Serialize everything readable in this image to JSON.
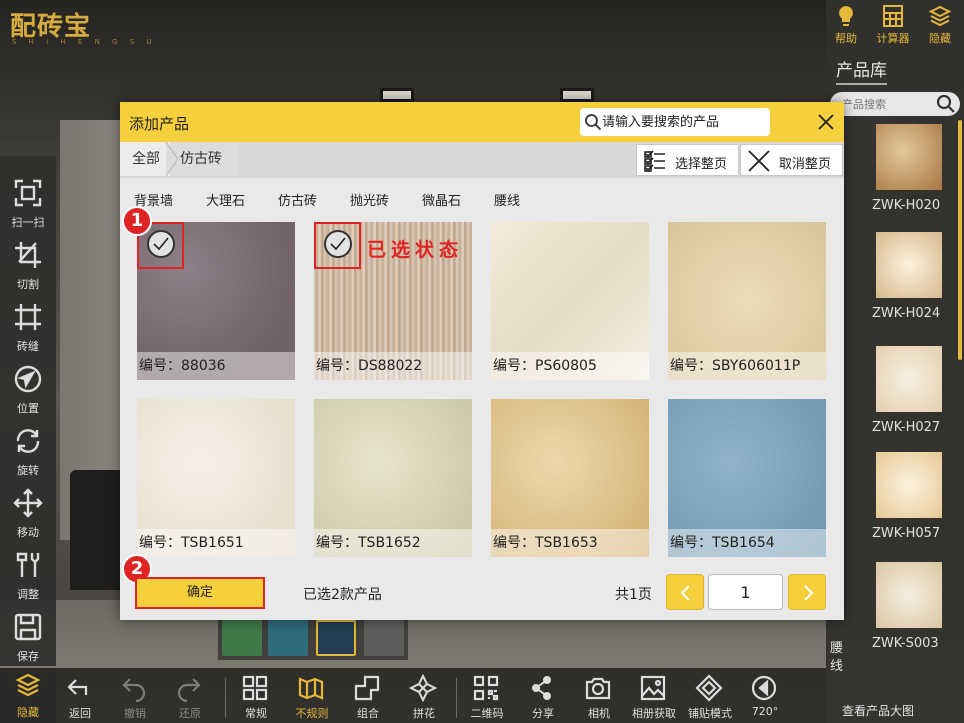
{
  "app": {
    "logo": "配砖宝",
    "logo_sub": "S H I H E N G S U"
  },
  "left_toolbar": [
    {
      "id": "scan",
      "label": "扫一扫",
      "icon": "scan-icon"
    },
    {
      "id": "cut",
      "label": "切割",
      "icon": "crop-icon"
    },
    {
      "id": "seam",
      "label": "砖缝",
      "icon": "grid-seam-icon"
    },
    {
      "id": "position",
      "label": "位置",
      "icon": "navigation-icon"
    },
    {
      "id": "rotate",
      "label": "旋转",
      "icon": "rotate-icon"
    },
    {
      "id": "move",
      "label": "移动",
      "icon": "move-icon"
    },
    {
      "id": "adjust",
      "label": "调整",
      "icon": "tools-icon"
    },
    {
      "id": "save",
      "label": "保存",
      "icon": "save-icon"
    }
  ],
  "bottom_toolbar": {
    "hide_label": "隐藏",
    "items": [
      {
        "label": "返回",
        "icon": "back-icon"
      },
      {
        "label": "撤销",
        "icon": "undo-icon"
      },
      {
        "label": "还原",
        "icon": "redo-icon"
      },
      {
        "label": "常规",
        "icon": "regular-grid-icon"
      },
      {
        "label": "不规则",
        "icon": "irregular-icon"
      },
      {
        "label": "组合",
        "icon": "combine-icon"
      },
      {
        "label": "拼花",
        "icon": "pattern-icon"
      },
      {
        "label": "二维码",
        "icon": "qrcode-icon"
      },
      {
        "label": "分享",
        "icon": "share-icon"
      },
      {
        "label": "相机",
        "icon": "camera-icon"
      },
      {
        "label": "相册获取",
        "icon": "album-icon"
      },
      {
        "label": "铺贴模式",
        "icon": "tiling-mode-icon"
      },
      {
        "label": "720°",
        "icon": "panorama-icon"
      }
    ]
  },
  "right_panel": {
    "top_buttons": [
      {
        "label": "帮助",
        "icon": "help-bulb-icon"
      },
      {
        "label": "计算器",
        "icon": "calculator-icon"
      },
      {
        "label": "隐藏",
        "icon": "layers-icon"
      }
    ],
    "title": "产品库",
    "search_placeholder": "产品搜索",
    "category": "腰线",
    "items": [
      {
        "code": "ZWK-H020"
      },
      {
        "code": "ZWK-H024"
      },
      {
        "code": "ZWK-H027"
      },
      {
        "code": "ZWK-H057"
      },
      {
        "code": "ZWK-S003"
      }
    ],
    "view_all": "查看产品大图"
  },
  "modal": {
    "title": "添加产品",
    "search_placeholder": "请输入要搜索的产品",
    "breadcrumb": {
      "home": "全部",
      "current": "仿古砖"
    },
    "select_all_label": "选择整页",
    "deselect_all_label": "取消整页",
    "tabs": [
      "背景墙",
      "大理石",
      "仿古砖",
      "抛光砖",
      "微晶石",
      "腰线"
    ],
    "products": [
      {
        "code": "编号：88036",
        "selected": true
      },
      {
        "code": "编号：DS88022",
        "selected": true
      },
      {
        "code": "编号：PS60805",
        "selected": false
      },
      {
        "code": "编号：SBY606011P",
        "selected": false
      },
      {
        "code": "编号：TSB1651",
        "selected": false
      },
      {
        "code": "编号：TSB1652",
        "selected": false
      },
      {
        "code": "编号：TSB1653",
        "selected": false
      },
      {
        "code": "编号：TSB1654",
        "selected": false
      }
    ],
    "annotation": "已选状态",
    "badge_1": "1",
    "badge_2": "2",
    "confirm_label": "确定",
    "selected_count": "已选2款产品",
    "page_total": "共1页",
    "current_page": "1"
  },
  "colors": {
    "accent": "#f6cf3c",
    "annotation": "#e02424",
    "toolbar_active": "#e5b83b"
  }
}
